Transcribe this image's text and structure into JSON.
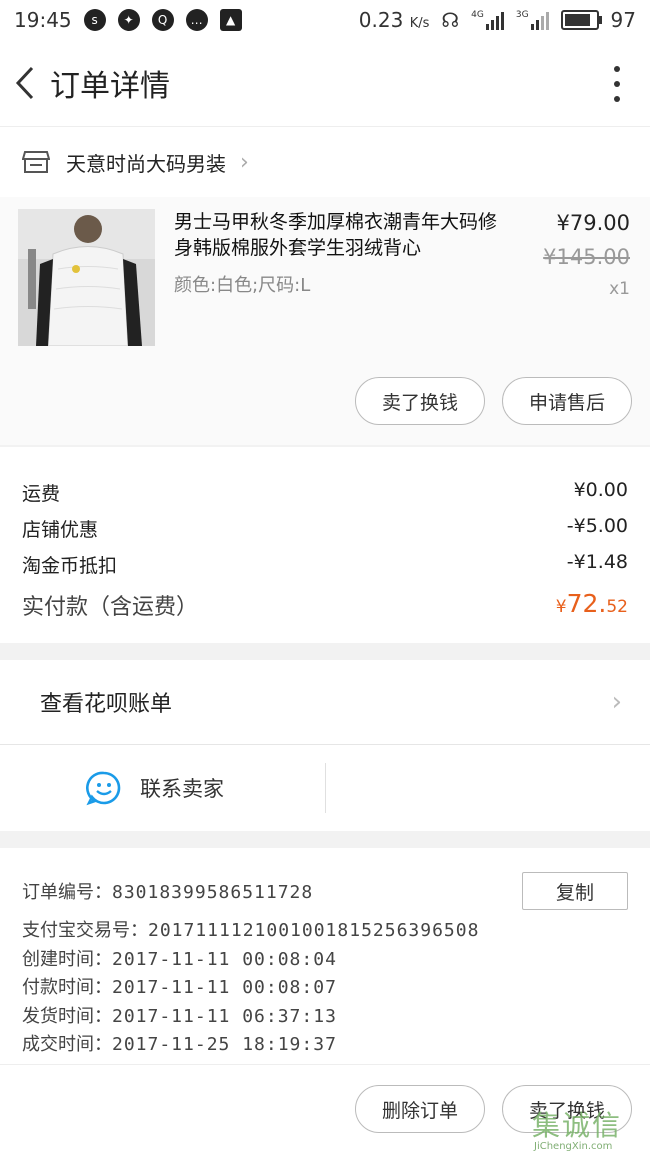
{
  "status_bar": {
    "time": "19:45",
    "net_speed": "0.23",
    "net_unit": "K/s",
    "net_type_1": "4G",
    "net_type_2": "3G",
    "battery": "97",
    "battery_level": 0.97
  },
  "header": {
    "title": "订单详情"
  },
  "shop": {
    "name": "天意时尚大码男装"
  },
  "product": {
    "name": "男士马甲秋冬季加厚棉衣潮青年大码修身韩版棉服外套学生羽绒背心",
    "spec": "颜色:白色;尺码:L",
    "price": "¥79.00",
    "original_price": "¥145.00",
    "quantity": "x1",
    "buttons": {
      "sell": "卖了换钱",
      "after_sale": "申请售后"
    }
  },
  "costs": {
    "rows": [
      {
        "label": "运费",
        "value": "¥0.00"
      },
      {
        "label": "店铺优惠",
        "value": "-¥5.00"
      },
      {
        "label": "淘金币抵扣",
        "value": "-¥1.48"
      }
    ],
    "total_label": "实付款（含运费）",
    "total_symbol": "¥",
    "total_int": "72.",
    "total_dec": "52",
    "accent": "#e8601c"
  },
  "huabei": {
    "label": "查看花呗账单"
  },
  "contact": {
    "label": "联系卖家",
    "accent": "#1a9be8"
  },
  "order_info": {
    "order_no_label": "订单编号：",
    "order_no": "830183995865117 28",
    "copy": "复制",
    "alipay_label": "支付宝交易号：",
    "alipay_no": "2017111121001001815256396508",
    "created_label": "创建时间：",
    "created": "2017-11-11 00:08:04",
    "paid_label": "付款时间：",
    "paid": "2017-11-11 00:08:07",
    "shipped_label": "发货时间：",
    "shipped": "2017-11-11 06:37:13",
    "closed_label": "成交时间：",
    "closed": "2017-11-25 18:19:37"
  },
  "footer": {
    "delete": "删除订单",
    "sell": "卖了换钱"
  },
  "watermark": {
    "text": "集诚信",
    "url_text": "JiChengXin.com"
  }
}
